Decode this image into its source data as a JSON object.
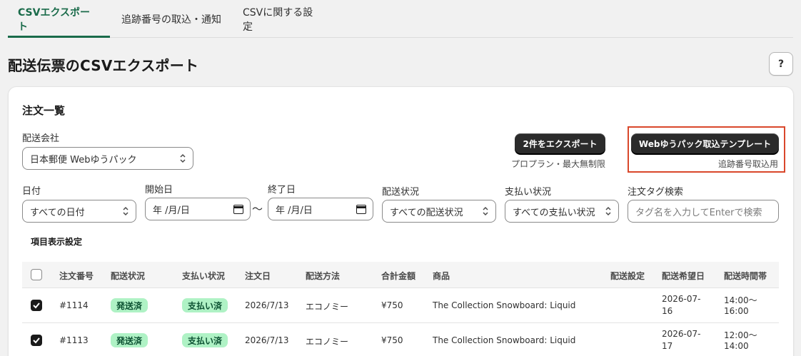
{
  "tabs": [
    "CSVエクスポート",
    "追跡番号の取込・通知",
    "CSVに関する設定"
  ],
  "page_title": "配送伝票のCSVエクスポート",
  "help_label": "?",
  "card_title": "注文一覧",
  "filters": {
    "carrier_label": "配送会社",
    "carrier_value": "日本郵便 Webゆうパック",
    "date_label": "日付",
    "date_value": "すべての日付",
    "start_label": "開始日",
    "start_value": "年 /月/日",
    "tilde": "〜",
    "end_label": "終了日",
    "end_value": "年 /月/日",
    "ship_status_label": "配送状況",
    "ship_status_value": "すべての配送状況",
    "pay_status_label": "支払い状況",
    "pay_status_value": "すべての支払い状況",
    "tag_label": "注文タグ検索",
    "tag_placeholder": "タグ名を入力してEnterで検索"
  },
  "export": {
    "button": "2件をエクスポート",
    "hint": "プロプラン・最大無制限"
  },
  "template": {
    "button": "Webゆうパック取込テンプレート",
    "hint": "追跡番号取込用"
  },
  "column_settings": "項目表示設定",
  "columns": [
    "注文番号",
    "配送状況",
    "支払い状況",
    "注文日",
    "配送方法",
    "合計金額",
    "商品",
    "配送設定",
    "配送希望日",
    "配送時間帯"
  ],
  "rows": [
    {
      "order": "#1114",
      "ship_status": "発送済",
      "pay_status": "支払い済",
      "date": "2026/7/13",
      "method": "エコノミー",
      "total": "¥750",
      "product": "The Collection Snowboard: Liquid",
      "ship_setting": "",
      "desired_date_1": "2026-07-",
      "desired_date_2": "16",
      "time_1": "14:00〜",
      "time_2": "16:00",
      "checked": true
    },
    {
      "order": "#1113",
      "ship_status": "発送済",
      "pay_status": "支払い済",
      "date": "2026/7/13",
      "method": "エコノミー",
      "total": "¥750",
      "product": "The Collection Snowboard: Liquid",
      "ship_setting": "",
      "desired_date_1": "2026-07-",
      "desired_date_2": "17",
      "time_1": "12:00〜",
      "time_2": "14:00",
      "checked": true
    }
  ],
  "colors": {
    "accent": "#1a6b4a",
    "badge_bg": "#aff2c5",
    "badge_text": "#0c5132",
    "highlight": "#d9472b",
    "button_dark": "#2b2b2b"
  }
}
